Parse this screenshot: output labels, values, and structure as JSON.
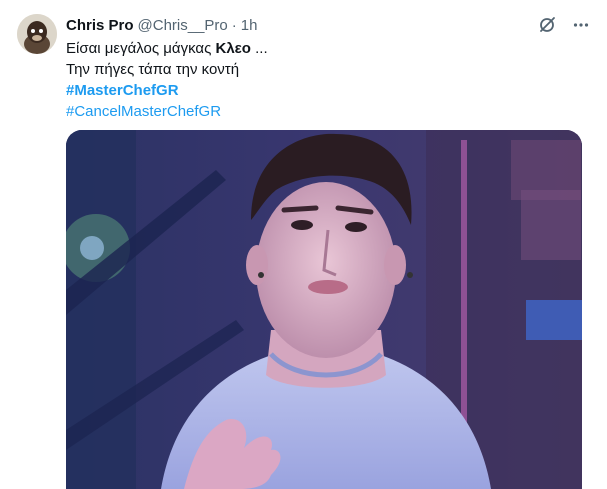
{
  "tweet": {
    "author": {
      "name": "Chris Pro",
      "handle": "@Chris__Pro",
      "separator": "·",
      "time": "1h"
    },
    "text": {
      "line1_prefix": "Είσαι μεγάλος μάγκας ",
      "line1_bold": "Κλεο",
      "line1_suffix": " ...",
      "line2": "Την πήγες τάπα την κοντή",
      "hashtag1": "#MasterChefGR",
      "hashtag2": "#CancelMasterChefGR"
    },
    "actions": [
      {
        "name": "grok-icon"
      },
      {
        "name": "more-icon"
      }
    ],
    "media": {
      "description_icon": "photo"
    },
    "colors": {
      "accent": "#1d9bf0",
      "secondary": "#536471",
      "text": "#0f1419"
    }
  }
}
